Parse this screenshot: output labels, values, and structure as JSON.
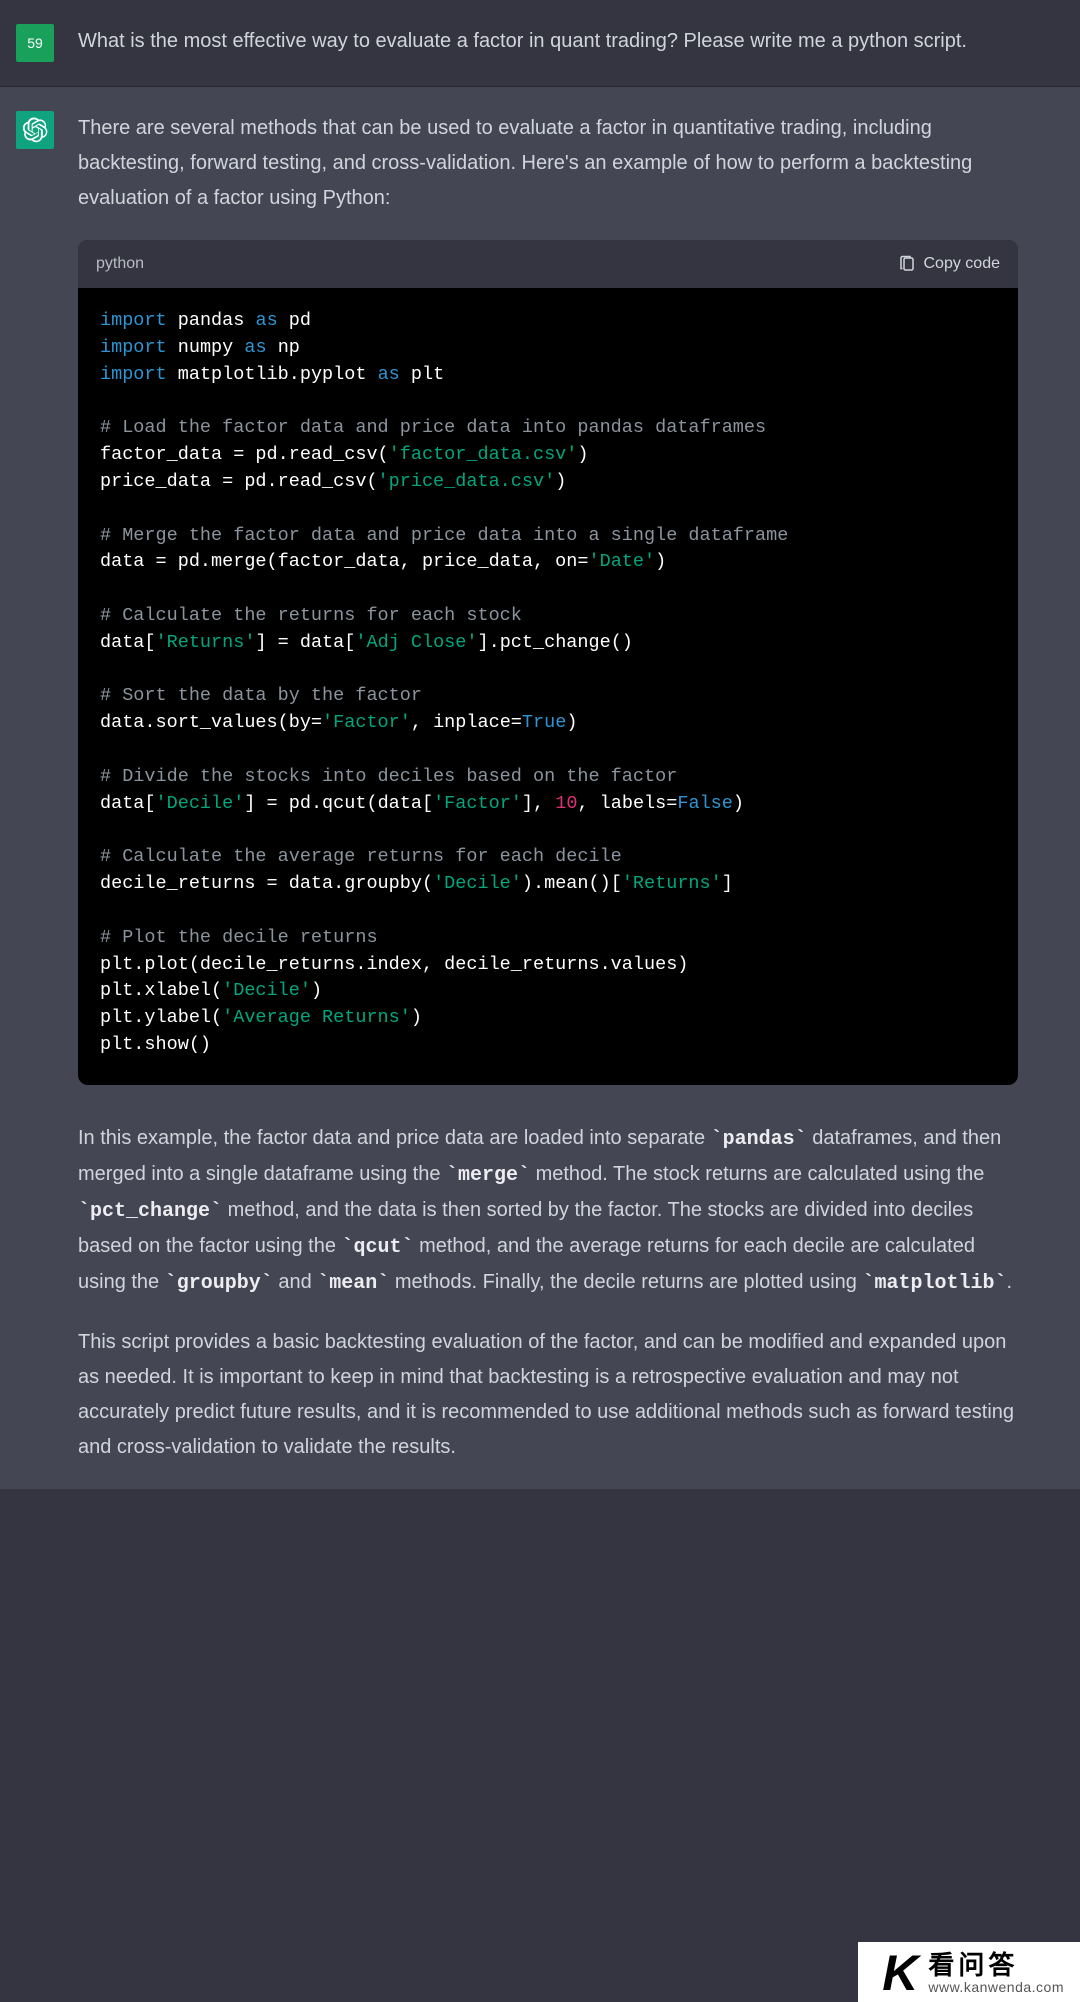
{
  "user": {
    "avatar_label": "59",
    "message": "What is the most effective way to evaluate a factor in quant trading? Please write me a python script."
  },
  "assistant": {
    "intro": "There are several methods that can be used to evaluate a factor in quantitative trading, including backtesting, forward testing, and cross-validation. Here's an example of how to perform a backtesting evaluation of a factor using Python:",
    "code": {
      "language": "python",
      "copy_label": "Copy code",
      "c1": "# Load the factor data and price data into pandas dataframes",
      "c2": "# Merge the factor data and price data into a single dataframe",
      "c3": "# Calculate the returns for each stock",
      "c4": "# Sort the data by the factor",
      "c5": "# Divide the stocks into deciles based on the factor",
      "c6": "# Calculate the average returns for each decile",
      "c7": "# Plot the decile returns",
      "s1": "'factor_data.csv'",
      "s2": "'price_data.csv'",
      "s3": "'Date'",
      "s4": "'Returns'",
      "s5": "'Adj Close'",
      "s6": "'Factor'",
      "s7": "'Decile'",
      "s8": "'Factor'",
      "s9": "'Decile'",
      "s10": "'Returns'",
      "s11": "'Decile'",
      "s12": "'Average Returns'",
      "n1": "10",
      "b1": "True",
      "b2": "False",
      "kw_import": "import",
      "kw_as": "as",
      "id_pandas": "pandas",
      "id_pd": "pd",
      "id_numpy": "numpy",
      "id_np": "np",
      "id_mpl": "matplotlib.pyplot",
      "id_plt": "plt"
    },
    "explain_p1_a": "In this example, the factor data and price data are loaded into separate ",
    "explain_p1_b": " dataframes, and then merged into a single dataframe using the ",
    "explain_p1_c": " method. The stock returns are calculated using the ",
    "explain_p1_d": " method, and the data is then sorted by the factor. The stocks are divided into deciles based on the factor using the ",
    "explain_p1_e": " method, and the average returns for each decile are calculated using the ",
    "explain_p1_f": " and ",
    "explain_p1_g": " methods. Finally, the decile returns are plotted using ",
    "explain_p1_h": ".",
    "inline_pandas": "`pandas`",
    "inline_merge": "`merge`",
    "inline_pct": "`pct_change`",
    "inline_qcut": "`qcut`",
    "inline_groupby": "`groupby`",
    "inline_mean": "`mean`",
    "inline_mpl": "`matplotlib`",
    "explain_p2": "This script provides a basic backtesting evaluation of the factor, and can be modified and expanded upon as needed. It is important to keep in mind that backtesting is a retrospective evaluation and may not accurately predict future results, and it is recommended to use additional methods such as forward testing and cross-validation to validate the results."
  },
  "watermark": {
    "cn": "看问答",
    "url": "www.kanwenda.com"
  }
}
